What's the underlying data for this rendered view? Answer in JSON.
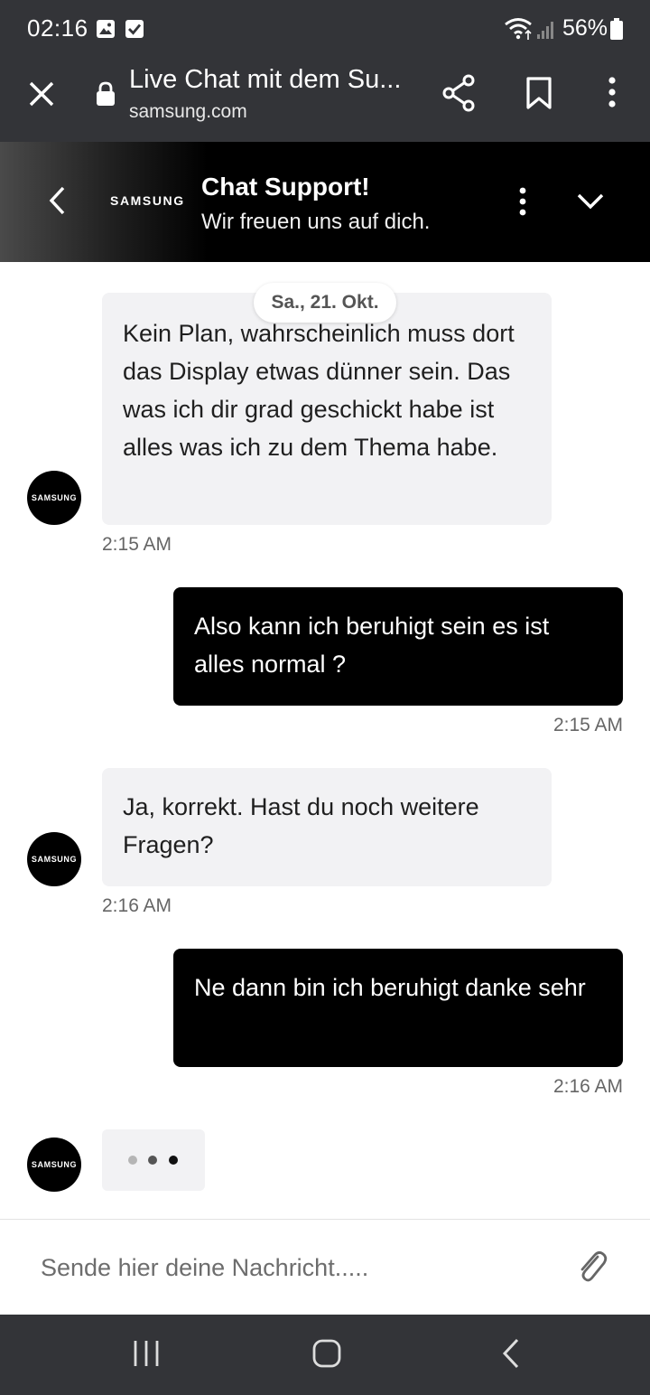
{
  "status_bar": {
    "time": "02:16",
    "battery_percent": "56%",
    "icons": [
      "image-notification-icon",
      "checkbox-notification-icon",
      "wifi-icon",
      "signal-icon",
      "battery-icon"
    ]
  },
  "browser": {
    "page_title": "Live Chat mit dem Su...",
    "url": "samsung.com"
  },
  "chat_header": {
    "logo": "SAMSUNG",
    "title": "Chat Support!",
    "subtitle": "Wir freuen uns auf dich."
  },
  "chat": {
    "date_label": "Sa., 21. Okt.",
    "avatar_label": "SAMSUNG",
    "messages": [
      {
        "from": "agent",
        "text": "Kein Plan, wahrscheinlich muss dort das Display etwas dünner sein. Das was ich dir grad geschickt habe ist alles was ich zu dem Thema habe.",
        "time": "2:15 AM"
      },
      {
        "from": "user",
        "text": "Also kann ich beruhigt sein es ist alles normal ?",
        "time": "2:15 AM"
      },
      {
        "from": "agent",
        "text": "Ja, korrekt. Hast du noch weitere Fragen?",
        "time": "2:16 AM"
      },
      {
        "from": "user",
        "text": "Ne dann bin ich beruhigt danke sehr",
        "time": "2:16 AM"
      }
    ]
  },
  "input": {
    "placeholder": "Sende hier deine Nachricht.....",
    "value": ""
  },
  "colors": {
    "system_bar": "#333438",
    "user_bubble": "#000000",
    "agent_bubble": "#f2f2f4"
  }
}
